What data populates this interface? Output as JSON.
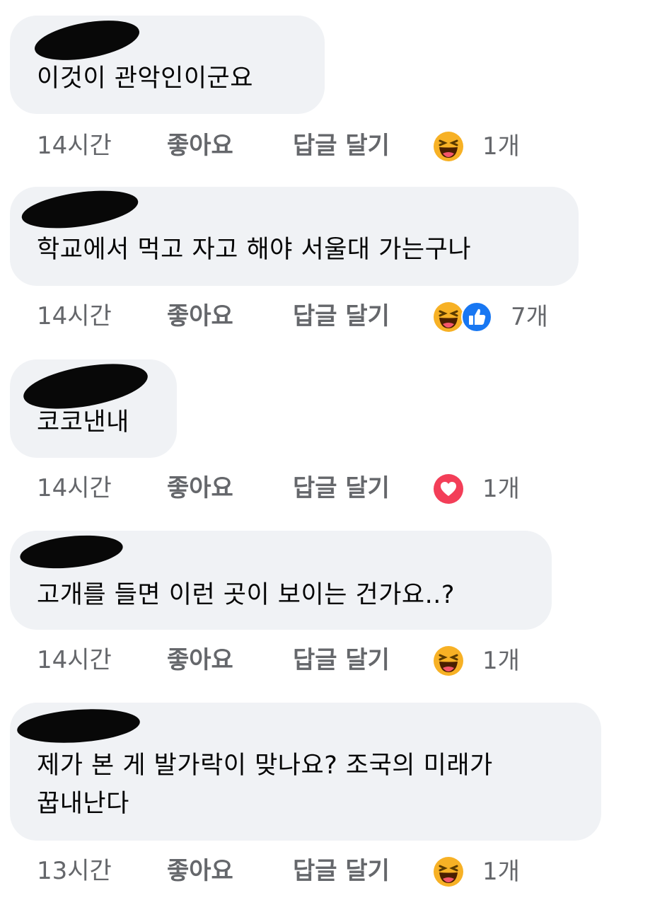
{
  "comments": [
    {
      "text": "이것이 관악인이군요",
      "time": "14시간",
      "like_label": "좋아요",
      "reply_label": "답글 달기",
      "reactions": [
        "haha"
      ],
      "reaction_count": "1개"
    },
    {
      "text": "학교에서 먹고 자고 해야 서울대 가는구나",
      "time": "14시간",
      "like_label": "좋아요",
      "reply_label": "답글 달기",
      "reactions": [
        "haha",
        "like"
      ],
      "reaction_count": "7개"
    },
    {
      "text": "코코낸내",
      "time": "14시간",
      "like_label": "좋아요",
      "reply_label": "답글 달기",
      "reactions": [
        "love"
      ],
      "reaction_count": "1개"
    },
    {
      "text": "고개를 들면 이런 곳이 보이는 건가요..?",
      "time": "14시간",
      "like_label": "좋아요",
      "reply_label": "답글 달기",
      "reactions": [
        "haha"
      ],
      "reaction_count": "1개"
    },
    {
      "text": "제가 본 게 발가락이 맞나요? 조국의 미래가\n꿉내난다",
      "time": "13시간",
      "like_label": "좋아요",
      "reply_label": "답글 달기",
      "reactions": [
        "haha"
      ],
      "reaction_count": "1개"
    }
  ],
  "colors": {
    "bubble": "#f0f2f5",
    "meta_text": "#65676b",
    "haha": "#f7b125",
    "like": "#1877f2",
    "love": "#f33e58"
  }
}
